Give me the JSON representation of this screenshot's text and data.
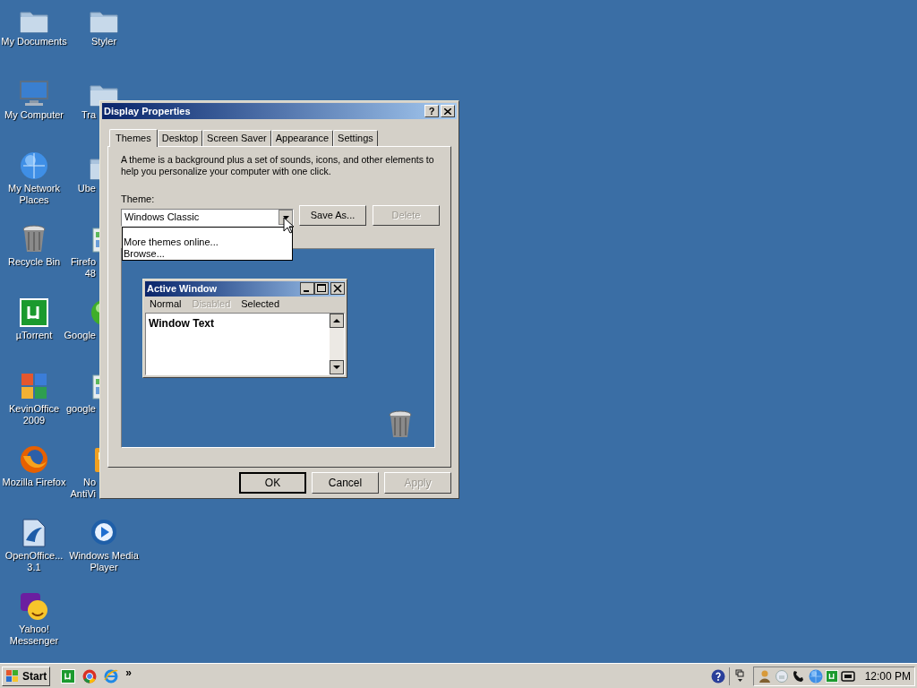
{
  "desktop": {
    "columns": [
      [
        {
          "label": "My Documents",
          "kind": "folder"
        },
        {
          "label": "My Computer",
          "kind": "monitor"
        },
        {
          "label": "My Network Places",
          "kind": "globe"
        },
        {
          "label": "Recycle Bin",
          "kind": "bin"
        },
        {
          "label": "µTorrent",
          "kind": "torrent"
        },
        {
          "label": "KevinOffice 2009",
          "kind": "office"
        },
        {
          "label": "Mozilla Firefox",
          "kind": "firefox"
        },
        {
          "label": "OpenOffice... 3.1",
          "kind": "openoffice"
        },
        {
          "label": "Yahoo! Messenger",
          "kind": "yahoo"
        }
      ],
      [
        {
          "label": "Styler",
          "kind": "folder",
          "partial": false
        },
        {
          "lines": [
            "Tra"
          ],
          "kind": "folder",
          "partial": true
        },
        {
          "lines": [
            "Ube"
          ],
          "kind": "folder",
          "partial": true
        },
        {
          "lines": [
            "Firefo",
            "48"
          ],
          "kind": "installer",
          "partial": true
        },
        {
          "lines": [
            "Google"
          ],
          "kind": "green",
          "partial": true
        },
        {
          "lines": [
            "google"
          ],
          "kind": "installer",
          "partial": true
        },
        {
          "lines": [
            "No",
            "AntiVi"
          ],
          "kind": "orange",
          "partial": true
        },
        {
          "label": "Windows Media Player",
          "kind": "media",
          "partial": false
        }
      ]
    ]
  },
  "dialog": {
    "title": "Display Properties",
    "help": "?",
    "tabs": [
      {
        "label": "Themes",
        "selected": true
      },
      {
        "label": "Desktop",
        "selected": false
      },
      {
        "label": "Screen Saver",
        "selected": false
      },
      {
        "label": "Appearance",
        "selected": false
      },
      {
        "label": "Settings",
        "selected": false
      }
    ],
    "description": "A theme is a background plus a set of sounds, icons, and other elements to help you personalize your computer with one click.",
    "theme_label": "Theme:",
    "theme_value": "Windows Classic",
    "dropdown_items": [
      "More themes online...",
      "Browse..."
    ],
    "side_buttons": [
      {
        "label": "Save As...",
        "disabled": false
      },
      {
        "label": "Delete",
        "disabled": true
      }
    ],
    "preview": {
      "title": "Active Window",
      "menu": [
        {
          "label": "Normal",
          "disabled": false
        },
        {
          "label": "Disabled",
          "disabled": true
        },
        {
          "label": "Selected",
          "disabled": false
        }
      ],
      "text": "Window Text"
    },
    "buttons": [
      {
        "label": "OK",
        "default": true,
        "disabled": false
      },
      {
        "label": "Cancel",
        "default": false,
        "disabled": false
      },
      {
        "label": "Apply",
        "default": false,
        "disabled": true
      }
    ]
  },
  "taskbar": {
    "start": "Start",
    "quick_launch": [
      {
        "kind": "torrent"
      },
      {
        "kind": "chrome"
      },
      {
        "kind": "ie"
      }
    ],
    "more": "»",
    "tray_left": [
      {
        "kind": "help"
      },
      {
        "kind": "network"
      }
    ],
    "tray": [
      {
        "kind": "person"
      },
      {
        "kind": "cloud"
      },
      {
        "kind": "phone"
      },
      {
        "kind": "globe"
      },
      {
        "kind": "torrent"
      },
      {
        "kind": "battery"
      }
    ],
    "clock": "12:00 PM"
  }
}
